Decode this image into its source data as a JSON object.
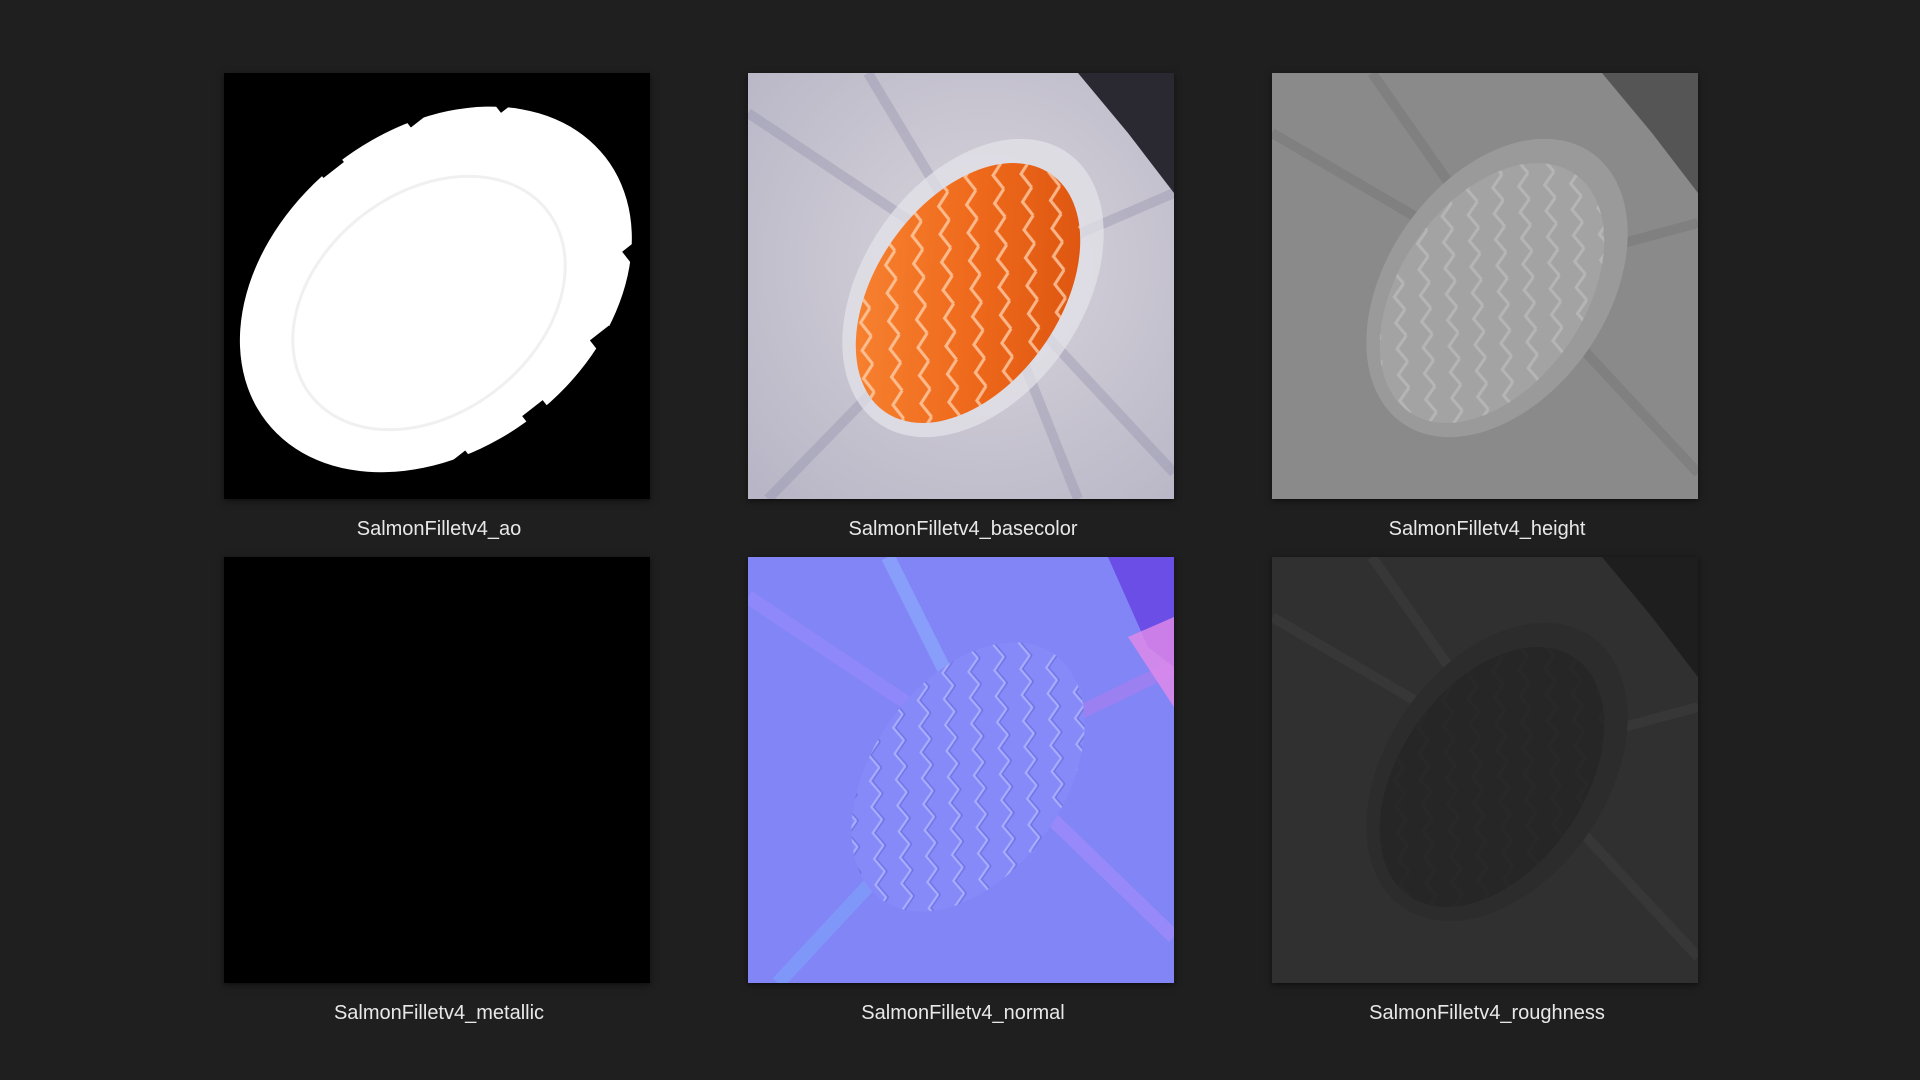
{
  "files": [
    {
      "name": "SalmonFilletv4_ao",
      "thumbnail": "ao-map"
    },
    {
      "name": "SalmonFilletv4_basecolor",
      "thumbnail": "basecolor-map"
    },
    {
      "name": "SalmonFilletv4_height",
      "thumbnail": "height-map"
    },
    {
      "name": "SalmonFilletv4_metallic",
      "thumbnail": "metallic-map"
    },
    {
      "name": "SalmonFilletv4_normal",
      "thumbnail": "normal-map"
    },
    {
      "name": "SalmonFilletv4_roughness",
      "thumbnail": "roughness-map"
    }
  ],
  "colors": {
    "background": "#1f1f1f",
    "label_text": "#e8e8e8",
    "salmon": "#ef6a1c",
    "normal_base": "#8080ff"
  }
}
